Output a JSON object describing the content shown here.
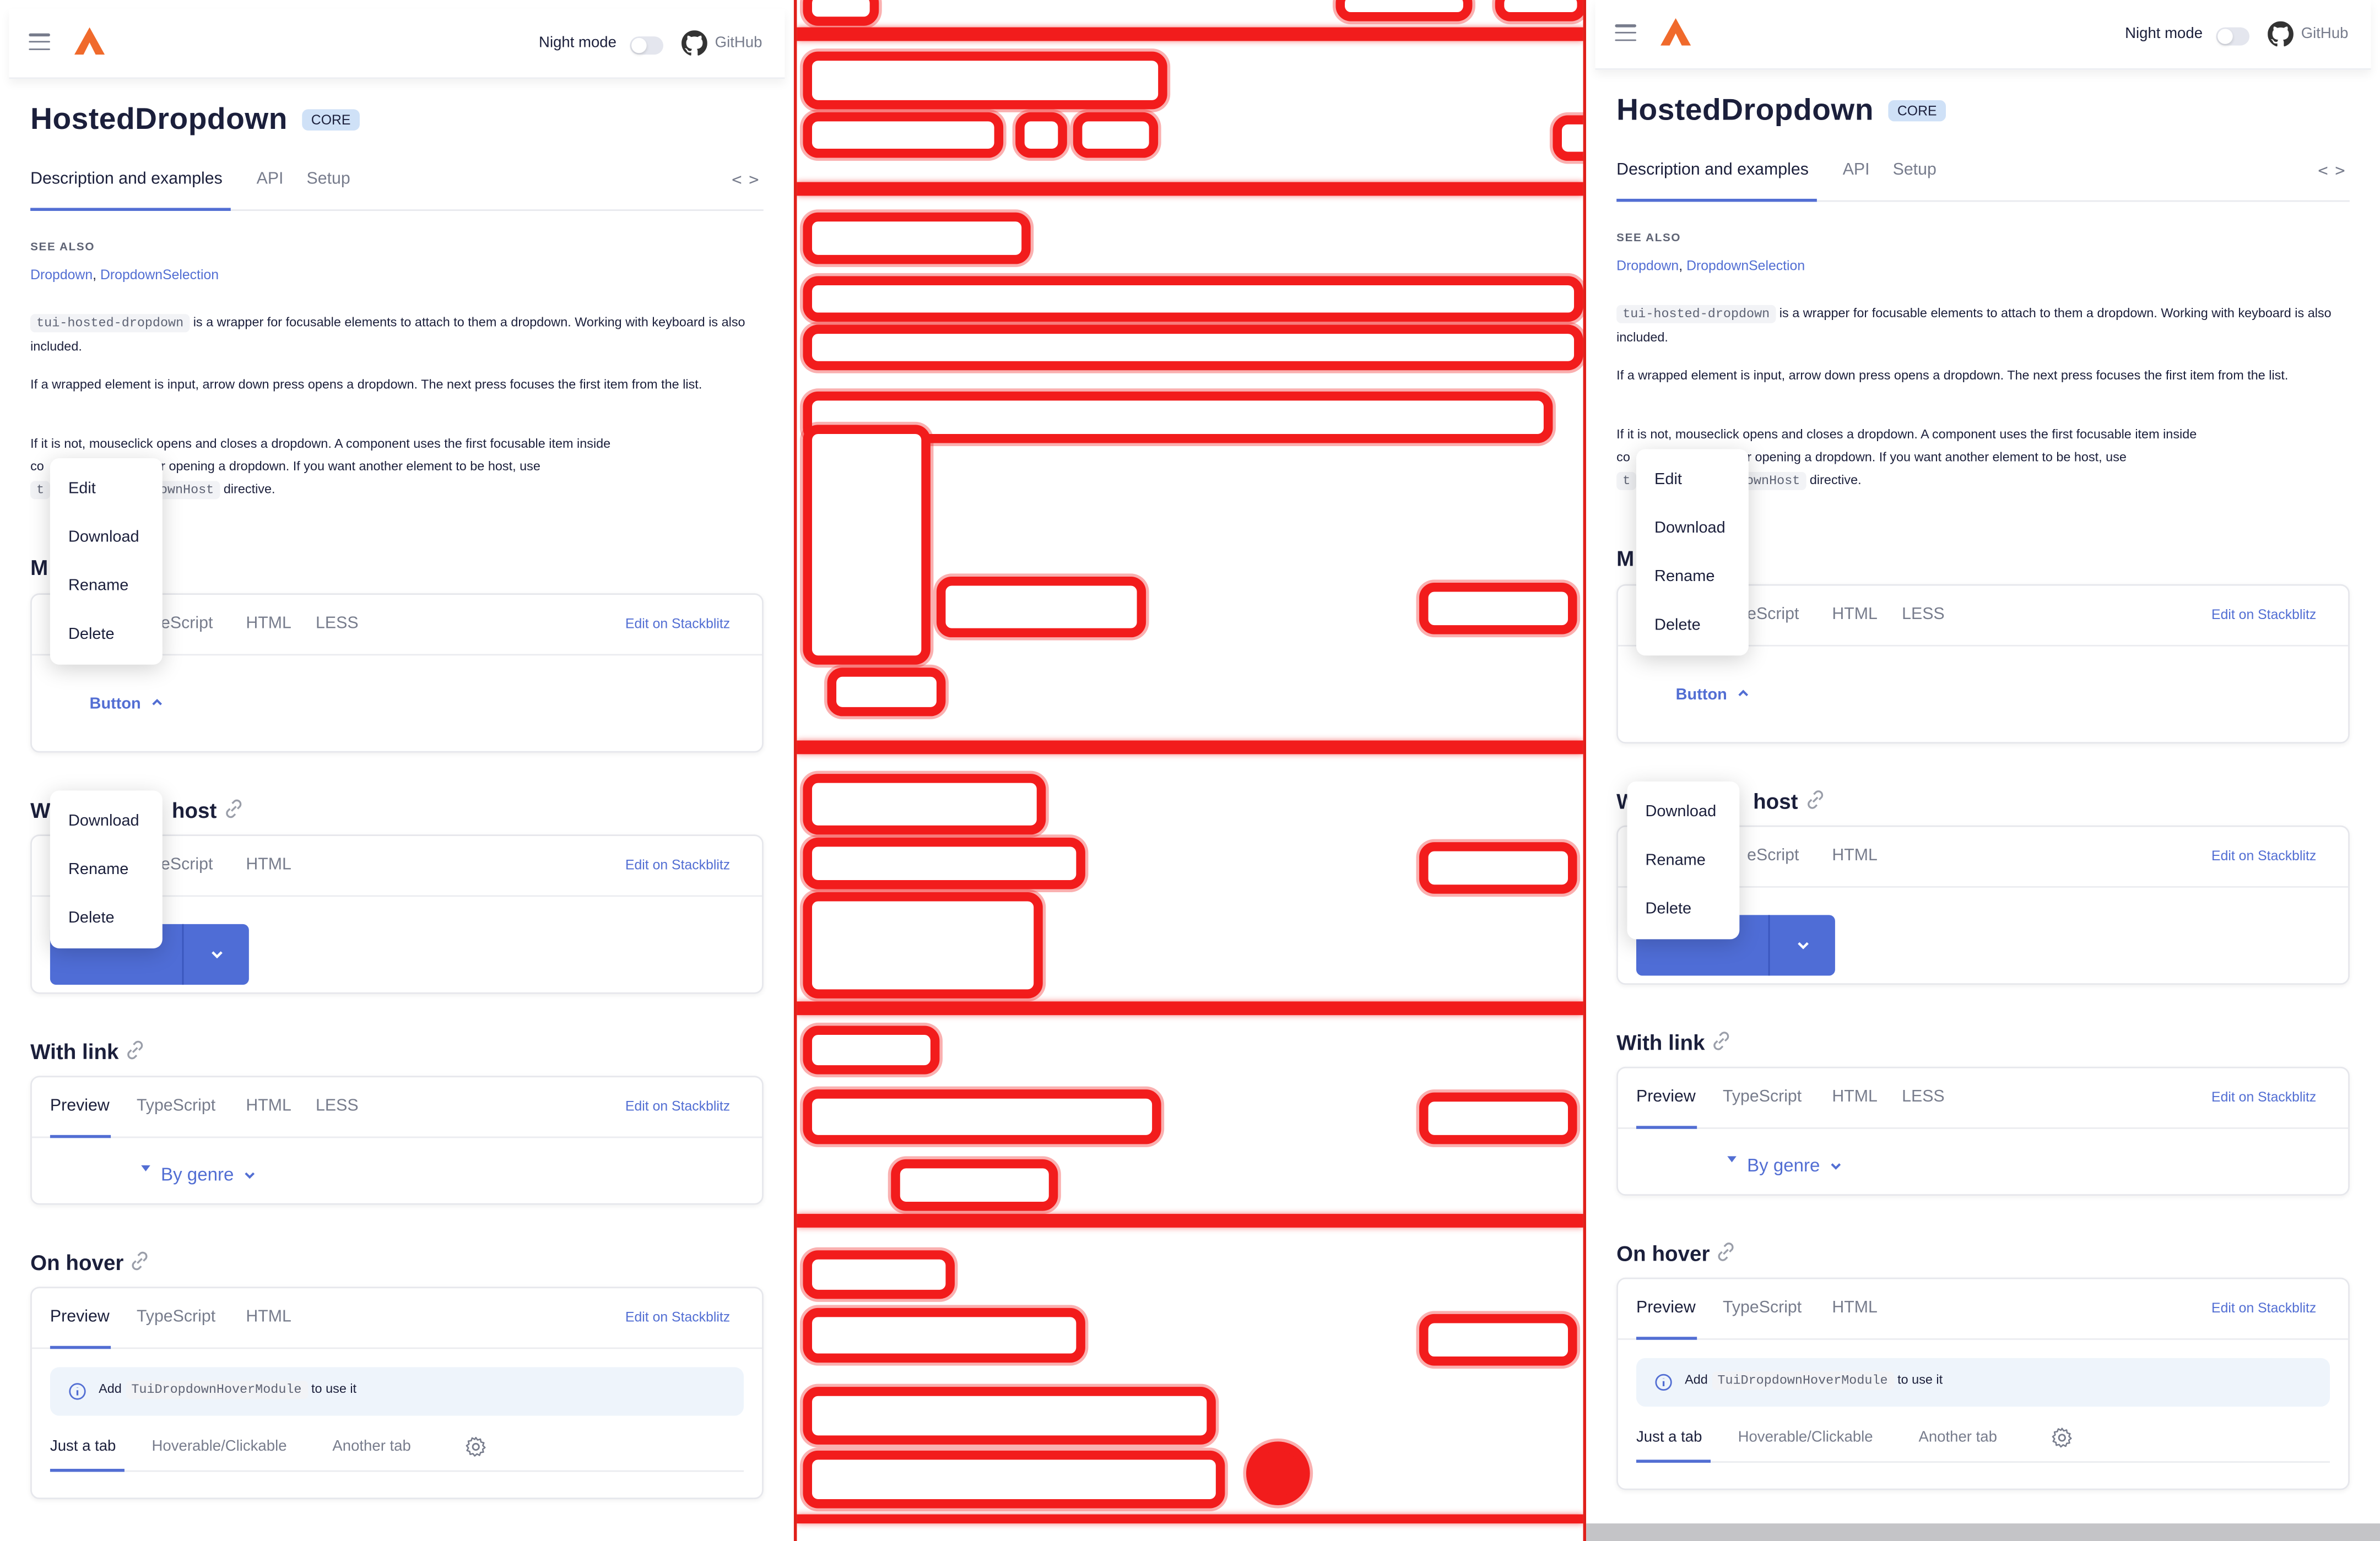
{
  "header": {
    "night_mode_label": "Night mode",
    "github_label": "GitHub"
  },
  "page": {
    "title": "HostedDropdown",
    "badge": "CORE",
    "tabs": [
      "Description and examples",
      "API",
      "Setup"
    ]
  },
  "see_also": {
    "label": "SEE ALSO",
    "links": [
      "Dropdown",
      "DropdownSelection"
    ],
    "separator": ","
  },
  "description": {
    "code1": "tui-hosted-dropdown",
    "p1_rest": "is a wrapper for focusable elements to attach to them a dropdown. Working with keyboard is also included.",
    "p2": "If a wrapped element is input, arrow down press opens a dropdown. The next press focuses the first item from the list.",
    "p3_a": "If it is not, mouseclick opens and closes a dropdown. A component uses the first focusable item inside",
    "p3_b1": "co",
    "p3_b2": "st for opening a dropdown. If you want another element to be host, use",
    "p3_c_code_start": "t",
    "code2": "downHost",
    "p3_c_rest": "directive."
  },
  "examples": {
    "edit_stackblitz": "Edit on Stackblitz",
    "ex1": {
      "heading_partial": "M",
      "tabs_visible": [
        "eScript",
        "HTML",
        "LESS"
      ],
      "button_label": "Button",
      "menu": [
        "Edit",
        "Download",
        "Rename",
        "Delete"
      ]
    },
    "ex2": {
      "heading_left": "W",
      "heading_right": "host",
      "tabs_visible": [
        "eScript",
        "HTML"
      ],
      "menu": [
        "Download",
        "Rename",
        "Delete"
      ]
    },
    "ex3": {
      "heading": "With link",
      "tabs": [
        "Preview",
        "TypeScript",
        "HTML",
        "LESS"
      ],
      "genre_label": "By genre"
    },
    "ex4": {
      "heading": "On hover",
      "tabs": [
        "Preview",
        "TypeScript",
        "HTML"
      ],
      "notice_add": "Add",
      "notice_code": "TuiDropdownHoverModule",
      "notice_rest": "to use it",
      "subtabs": [
        "Just a tab",
        "Hoverable/Clickable",
        "Another tab"
      ]
    }
  },
  "right_panel": {
    "ex2_heading_left": "Wi"
  },
  "colors": {
    "accent": "#526ed3",
    "logo": "#f06a2c",
    "diff_red": "#f21c1c"
  },
  "icons": [
    "menu-icon",
    "logo-icon",
    "github-icon",
    "code-icon",
    "link-icon",
    "chevron-up-icon",
    "chevron-down-icon",
    "caret-down-icon",
    "info-icon",
    "gear-icon"
  ]
}
